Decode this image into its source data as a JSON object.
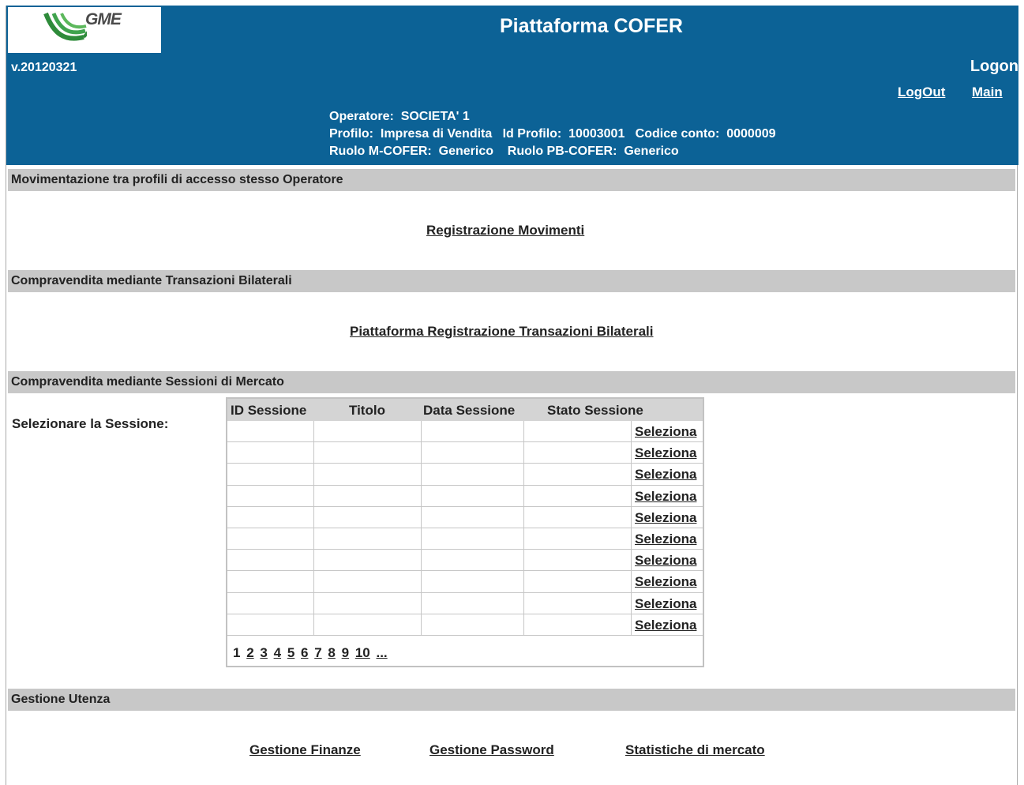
{
  "header": {
    "logo_text": "GME",
    "title": "Piattaforma COFER",
    "version": "v.20120321",
    "logon_label": "Logon",
    "logout_link": "LogOut",
    "main_link": "Main",
    "operator_line": "Operatore:  SOCIETA' 1",
    "profile_line": "Profilo:  Impresa di Vendita   Id Profilo:  10003001   Codice conto:  0000009",
    "role_line": "Ruolo M-COFER:  Generico    Ruolo PB-COFER:  Generico"
  },
  "sections": {
    "movimentazione": {
      "title": "Movimentazione tra profili di accesso stesso Operatore",
      "link": "Registrazione Movimenti"
    },
    "bilaterali": {
      "title": "Compravendita mediante Transazioni Bilaterali",
      "link": "Piattaforma Registrazione Transazioni Bilaterali"
    },
    "mercato": {
      "title": "Compravendita mediante Sessioni di Mercato",
      "select_label": "Selezionare la Sessione:",
      "columns": [
        "ID Sessione",
        "Titolo",
        "Data Sessione",
        "Stato Sessione"
      ],
      "rows": [
        {
          "action": "Seleziona"
        },
        {
          "action": "Seleziona"
        },
        {
          "action": "Seleziona"
        },
        {
          "action": "Seleziona"
        },
        {
          "action": "Seleziona"
        },
        {
          "action": "Seleziona"
        },
        {
          "action": "Seleziona"
        },
        {
          "action": "Seleziona"
        },
        {
          "action": "Seleziona"
        },
        {
          "action": "Seleziona"
        }
      ],
      "pager": {
        "current": "1",
        "pages": [
          "2",
          "3",
          "4",
          "5",
          "6",
          "7",
          "8",
          "9",
          "10",
          "..."
        ]
      }
    },
    "utenza": {
      "title": "Gestione Utenza",
      "links": [
        "Gestione Finanze",
        "Gestione Password",
        "Statistiche di mercato"
      ]
    }
  },
  "colors": {
    "header_bg": "#0c6296",
    "section_bar": "#c8c8c8",
    "logo_green": "#2e8b3a"
  }
}
